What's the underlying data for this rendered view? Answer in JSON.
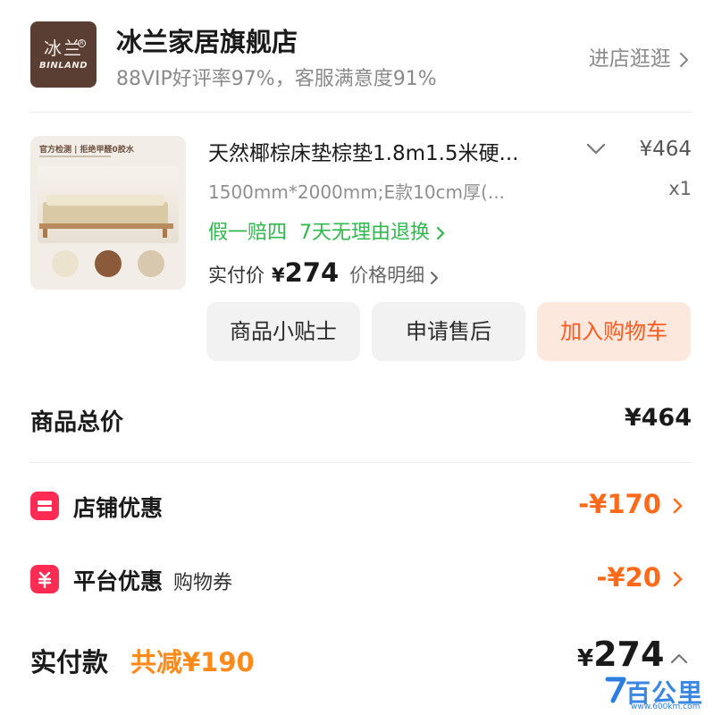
{
  "store": {
    "logo_cn": "冰兰",
    "logo_en": "BINLAND",
    "name": "冰兰家居旗舰店",
    "rating": "88VIP好评率97%，客服满意度91%",
    "visit_label": "进店逛逛"
  },
  "product": {
    "image_caption": "官方检测 | 拒绝甲醛0胶水",
    "title": "天然椰棕床垫棕垫1.8m1.5米硬...",
    "price": "¥464",
    "spec": "1500mm*2000mm;E款10cm厚(...",
    "quantity": "x1",
    "guarantees": [
      "假一赔四",
      "7天无理由退换"
    ],
    "paid_label": "实付价",
    "paid_yen": "¥",
    "paid_amount": "274",
    "price_detail_label": "价格明细"
  },
  "actions": {
    "tips": "商品小贴士",
    "after_sale": "申请售后",
    "add_cart": "加入购物车"
  },
  "summary": {
    "total_label": "商品总价",
    "total_value": "¥464",
    "shop_discount_label": "店铺优惠",
    "shop_discount_value": "-¥170",
    "platform_discount_label": "平台优惠",
    "platform_discount_sub": "购物券",
    "platform_discount_value": "-¥20",
    "paid_label": "实付款",
    "saved_label": "共减¥190",
    "paid_yen": "¥",
    "paid_amount": "274"
  },
  "watermark": {
    "text": "百公里",
    "url": "www.600km.com"
  },
  "colors": {
    "accent_orange": "#ff6a1a",
    "green": "#2fb84c",
    "coupon_red": "#ff2b52",
    "cart_bg": "#fde8de"
  }
}
